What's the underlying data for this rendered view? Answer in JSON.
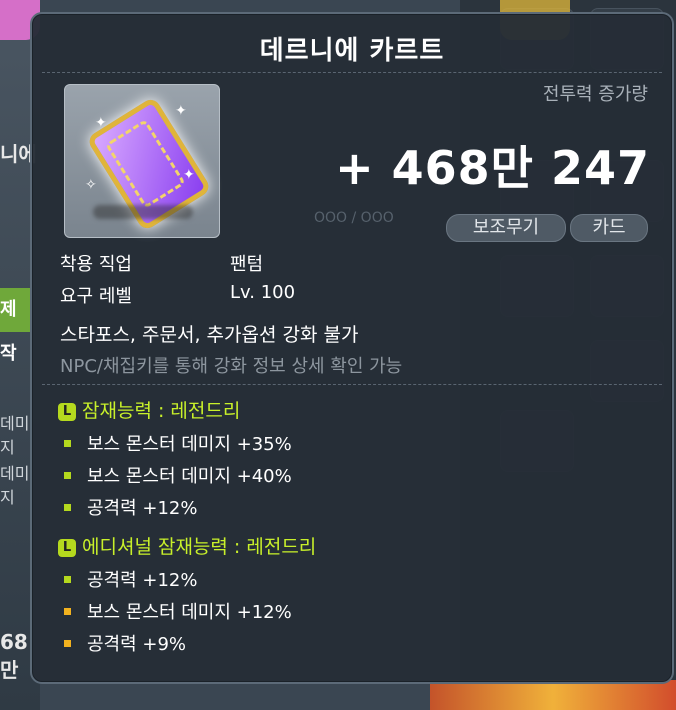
{
  "item": {
    "name": "데르니에 카르트",
    "power_label": "전투력 증가량",
    "power_value": "+ 468만 247",
    "slot_ghost": "OOO / OOO",
    "tags": [
      "보조무기",
      "카드"
    ],
    "job_label": "착용 직업",
    "job_value": "팬텀",
    "level_label": "요구 레벨",
    "level_value": "Lv. 100",
    "notice": "스타포스, 주문서, 추가옵션 강화 불가",
    "hint": "NPC/채집키를 통해 강화 정보 상세 확인 가능"
  },
  "potential": {
    "badge": "L",
    "title": "잠재능력 : 레전드리",
    "lines": [
      "보스 몬스터 데미지 +35%",
      "보스 몬스터 데미지 +40%",
      "공격력 +12%"
    ]
  },
  "additional": {
    "badge": "L",
    "title": "에디셔널 잠재능력 : 레전드리",
    "lines": [
      "공격력 +12%",
      "보스 몬스터 데미지 +12%",
      "공격력 +9%"
    ]
  },
  "colors": {
    "legendary": "#c8f02a",
    "bullet_main": "#b5d91e",
    "bullet_additional": "#f2b21f"
  },
  "background": {
    "left_texts": [
      "니에",
      "데미지",
      "데미지",
      "68만"
    ],
    "left_button": "제작"
  }
}
